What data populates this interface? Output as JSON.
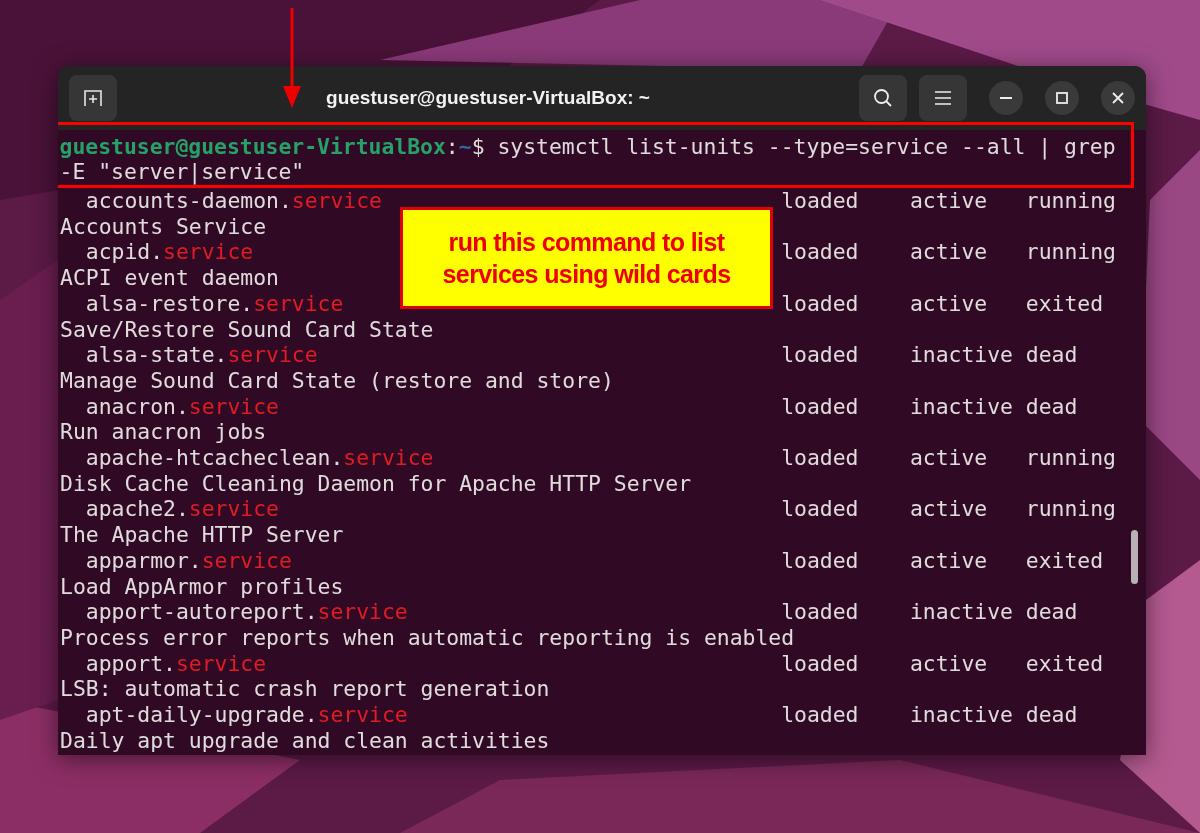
{
  "window": {
    "title": "guestuser@guestuser-VirtualBox: ~"
  },
  "prompt": {
    "user_host": "guestuser@guestuser-VirtualBox",
    "separator": ":",
    "path": "~",
    "symbol": "$",
    "command": "systemctl list-units --type=service --all | grep -E \"server|service\""
  },
  "rows": [
    {
      "name": "accounts-daemon.",
      "match": "service",
      "load": "loaded",
      "active": "active",
      "sub": "running",
      "description": "Accounts Service"
    },
    {
      "name": "acpid.",
      "match": "service",
      "load": "loaded",
      "active": "active",
      "sub": "running",
      "description": "ACPI event daemon"
    },
    {
      "name": "alsa-restore.",
      "match": "service",
      "load": "loaded",
      "active": "active",
      "sub": "exited",
      "description": "Save/Restore Sound Card State"
    },
    {
      "name": "alsa-state.",
      "match": "service",
      "load": "loaded",
      "active": "inactive",
      "sub": "dead",
      "description": "Manage Sound Card State (restore and store)"
    },
    {
      "name": "anacron.",
      "match": "service",
      "load": "loaded",
      "active": "inactive",
      "sub": "dead",
      "description": "Run anacron jobs"
    },
    {
      "name": "apache-htcacheclean.",
      "match": "service",
      "load": "loaded",
      "active": "active",
      "sub": "running",
      "description": "Disk Cache Cleaning Daemon for Apache HTTP Server"
    },
    {
      "name": "apache2.",
      "match": "service",
      "load": "loaded",
      "active": "active",
      "sub": "running",
      "description": "The Apache HTTP Server"
    },
    {
      "name": "apparmor.",
      "match": "service",
      "load": "loaded",
      "active": "active",
      "sub": "exited",
      "description": "Load AppArmor profiles"
    },
    {
      "name": "apport-autoreport.",
      "match": "service",
      "load": "loaded",
      "active": "inactive",
      "sub": "dead",
      "description": "Process error reports when automatic reporting is enabled"
    },
    {
      "name": "apport.",
      "match": "service",
      "load": "loaded",
      "active": "active",
      "sub": "exited",
      "description": "LSB: automatic crash report generation"
    },
    {
      "name": "apt-daily-upgrade.",
      "match": "service",
      "load": "loaded",
      "active": "inactive",
      "sub": "dead",
      "description": "Daily apt upgrade and clean activities"
    }
  ],
  "callout": {
    "text": "run this command to list services using wild cards"
  }
}
